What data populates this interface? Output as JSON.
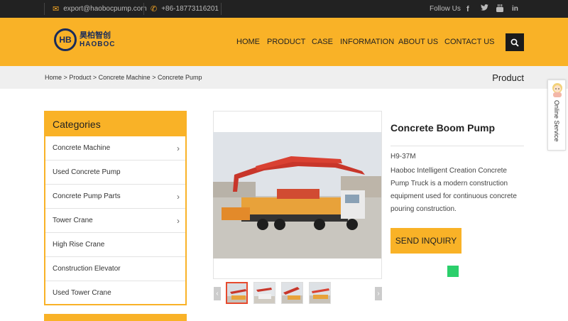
{
  "topbar": {
    "email": "export@haobocpump.com",
    "phone": "+86-18773116201",
    "follow_label": "Follow Us",
    "social_icons": [
      "facebook-icon",
      "twitter-icon",
      "youtube-icon",
      "linkedin-icon"
    ]
  },
  "brand": {
    "logo_cn": "昊柏智创",
    "logo_en": "HAOBOC",
    "logo_mark": "HB"
  },
  "nav": {
    "items": [
      "HOME",
      "PRODUCT",
      "CASE",
      "INFORMATION",
      "ABOUT US",
      "CONTACT US"
    ]
  },
  "breadcrumb": {
    "home": "Home",
    "sep": ">",
    "product": "Product",
    "category": "Concrete Machine",
    "current": "Concrete Pump",
    "section_title": "Product"
  },
  "categories": {
    "title": "Categories",
    "items": [
      {
        "label": "Concrete Machine",
        "has_sub": true
      },
      {
        "label": "Used Concrete Pump",
        "has_sub": false
      },
      {
        "label": "Concrete Pump Parts",
        "has_sub": true
      },
      {
        "label": "Tower Crane",
        "has_sub": true
      },
      {
        "label": "High Rise Crane",
        "has_sub": false
      },
      {
        "label": "Construction Elevator",
        "has_sub": false
      },
      {
        "label": "Used Tower Crane",
        "has_sub": false
      }
    ]
  },
  "product": {
    "title": "Concrete Boom Pump",
    "model": "H9-37M",
    "description": "Haoboc Intelligent Creation Concrete Pump Truck is a modern construction equipment used for continuous concrete pouring construction.",
    "inquiry_label": "SEND INQUIRY",
    "thumb_count": 4
  },
  "online_service": {
    "label": "Online Service"
  },
  "colors": {
    "accent": "#f9b227",
    "topbar_bg": "#222222",
    "nav_dark": "#1b1b1b",
    "thumb_active": "#e64a2e",
    "status_green": "#2bcf6b"
  }
}
